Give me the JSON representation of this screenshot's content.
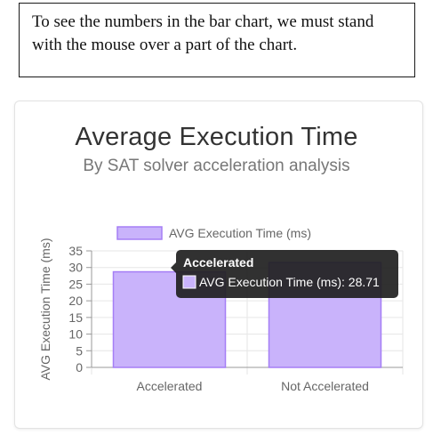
{
  "note": {
    "text": "To see the numbers in the bar chart, we must stand with the mouse over a part of the chart."
  },
  "chart_data": {
    "type": "bar",
    "title": "Average Execution Time",
    "subtitle": "By SAT solver acceleration analysis",
    "ylabel": "AVG Execution Time (ms)",
    "xlabel": "",
    "categories": [
      "Accelerated",
      "Not Accelerated"
    ],
    "series": [
      {
        "name": "AVG Execution Time (ms)",
        "values": [
          28.71,
          31.5
        ]
      }
    ],
    "ylim": [
      0,
      35
    ],
    "yticks": [
      0,
      5,
      10,
      15,
      20,
      25,
      30,
      35
    ],
    "grid": true,
    "legend": "top",
    "colors": {
      "bar_fill": "#c9b3fb",
      "bar_stroke": "#a57ef5",
      "grid": "#e6e6e6",
      "tooltip_bg": "#1f1f1f"
    }
  },
  "tooltip": {
    "title": "Accelerated",
    "text": "AVG Execution Time (ms): 28.71"
  }
}
